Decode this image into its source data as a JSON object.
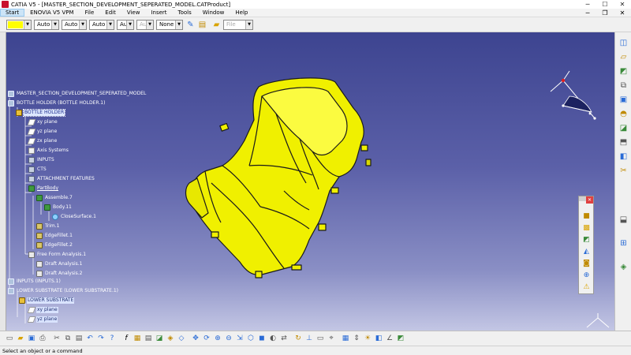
{
  "window": {
    "title": "CATIA V5 - [MASTER_SECTION_DEVELOPMENT_SEPERATED_MODEL.CATProduct]",
    "minimize": "─",
    "maximize": "☐",
    "close": "✕"
  },
  "menu": {
    "items": [
      "Start",
      "ENOVIA V5 VPM",
      "File",
      "Edit",
      "View",
      "Insert",
      "Tools",
      "Window",
      "Help"
    ],
    "right_controls": [
      "─",
      "❐",
      "✕"
    ]
  },
  "toolbar": {
    "color_value": "",
    "transparency_value": "Auto",
    "linetype_value": "Auto",
    "thickness_value": "Auto",
    "pointstyle_value": "Aut",
    "layer_value": "Aut",
    "layer_filter_value": "None",
    "file_value": "File",
    "color_swatch": "#ffff00"
  },
  "tree": {
    "nodes": [
      {
        "label": "MASTER_SECTION_DEVELOPMENT_SEPERATED_MODEL",
        "icon": "product",
        "level": 0
      },
      {
        "label": "BOTTLE HOLDER (BOTTLE HOLDER.1)",
        "icon": "product",
        "level": 0
      },
      {
        "label": "BOTTLE HOLDER",
        "icon": "part",
        "level": 1,
        "selected": true
      },
      {
        "label": "xy plane",
        "icon": "plane",
        "level": 2
      },
      {
        "label": "yz plane",
        "icon": "plane",
        "level": 2
      },
      {
        "label": "zx plane",
        "icon": "plane",
        "level": 2
      },
      {
        "label": "Axis Systems",
        "icon": "axis",
        "level": 2
      },
      {
        "label": "INPUTS",
        "icon": "geoset",
        "level": 2
      },
      {
        "label": "CTS",
        "icon": "geoset",
        "level": 2
      },
      {
        "label": "ATTACHMENT FEATURES",
        "icon": "geoset",
        "level": 2
      },
      {
        "label": "PartBody",
        "icon": "body",
        "level": 2
      },
      {
        "label": "Assemble.7",
        "icon": "body",
        "level": 3
      },
      {
        "label": "Body.11",
        "icon": "body",
        "level": 4
      },
      {
        "label": "CloseSurface.1",
        "icon": "surface",
        "level": 5
      },
      {
        "label": "Trim.1",
        "icon": "feature",
        "level": 3
      },
      {
        "label": "EdgeFillet.1",
        "icon": "feature",
        "level": 3
      },
      {
        "label": "EdgeFillet.2",
        "icon": "feature",
        "level": 3
      },
      {
        "label": "Free Form Analysis.1",
        "icon": "analysis",
        "level": 2
      },
      {
        "label": "Draft Analysis.1",
        "icon": "analysis",
        "level": 3
      },
      {
        "label": "Draft Analysis.2",
        "icon": "analysis",
        "level": 3
      },
      {
        "label": "INPUTS (INPUTS.1)",
        "icon": "product",
        "level": 0
      },
      {
        "label": "LOWER SUBSTRATE (LOWER SUBSTRATE.1)",
        "icon": "product",
        "level": 0
      },
      {
        "label": "LOWER SUBSTRATE",
        "icon": "part",
        "level": 1,
        "highlight": true
      },
      {
        "label": "xy plane",
        "icon": "plane",
        "level": 2,
        "highlight": true
      },
      {
        "label": "yz plane",
        "icon": "plane",
        "level": 2,
        "highlight": true
      }
    ]
  },
  "status": {
    "text": "Select an object or a command"
  },
  "colors": {
    "background_top": "#3d4490",
    "background_bottom": "#c3c6e4",
    "part_fill": "#f0f000",
    "part_edge": "#1a1a1a",
    "compass_red": "#e02020",
    "compass_navy": "#1c2260"
  },
  "icons": {
    "top_toolbar": [
      "brush-icon",
      "open-folder-icon"
    ],
    "right_toolbar": [
      "sketch-icon",
      "plane-icon",
      "surface-icon",
      "join-icon",
      "extrude-icon",
      "fillet-icon",
      "sweep-icon",
      "blend-icon",
      "offset-icon",
      "trim-icon",
      "split-icon",
      "measure-icon",
      "analysis-icon"
    ],
    "floating_toolbar": [
      "cube-icon",
      "box-icon",
      "shell-icon",
      "wedge-icon",
      "cylinder-icon",
      "target-icon",
      "circle-icon",
      "warning-icon"
    ],
    "bottom_toolbar": [
      "new-icon",
      "open-icon",
      "save-icon",
      "print-icon",
      "cut-icon",
      "copy-icon",
      "paste-icon",
      "undo-icon",
      "redo-icon",
      "help-icon",
      "formula-icon",
      "catalog-icon",
      "table-icon",
      "knowledge-icon",
      "parameters-icon",
      "fly-icon",
      "pan-icon",
      "rotate-icon",
      "zoom-in-icon",
      "zoom-out-icon",
      "normal-view-icon",
      "iso-view-icon",
      "shading-icon",
      "hide-icon",
      "swap-icon",
      "update-icon",
      "axis-icon",
      "ruler-icon",
      "snap-icon",
      "grid-icon",
      "scale-icon",
      "light-icon",
      "sectioning-icon",
      "angle-icon",
      "draft-icon"
    ]
  }
}
